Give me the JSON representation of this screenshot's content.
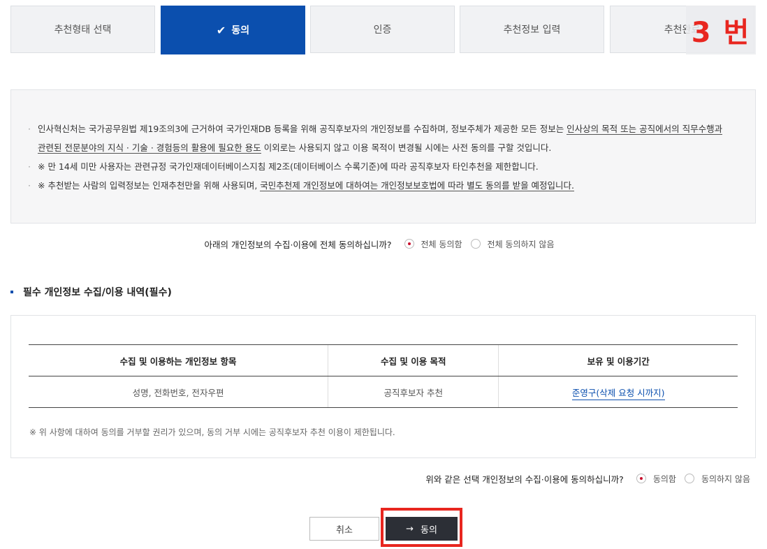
{
  "steps": [
    {
      "label": "추천형태 선택",
      "active": false
    },
    {
      "label": "동의",
      "active": true
    },
    {
      "label": "인증",
      "active": false
    },
    {
      "label": "추천정보 입력",
      "active": false
    },
    {
      "label": "추천완료",
      "active": false
    }
  ],
  "overlay_label": "3 번",
  "notice": {
    "line1_a": "인사혁신처는 국가공무원법 제19조의3에 근거하여 국가인재DB 등록을 위해 공직후보자의 개인정보를 수집하며, 정보주체가 제공한 모든 정보는 ",
    "line1_u": "인사상의 목적 또는 공직에서의 직무수행과",
    "line2_u": "관련된 전문분야의 지식 · 기술 · 경험등의 활용에 필요한 용도",
    "line2_b": " 이외로는 사용되지 않고 이용 목적이 변경될 시에는 사전 동의를 구할 것입니다.",
    "line3": "※ 만 14세 미만 사용자는 관련규정 국가인재데이터베이스지침 제2조(데이터베이스 수록기준)에 따라 공직후보자 타인추천을 제한합니다.",
    "line4_a": "※ 추천받는 사람의 입력정보는 인재추천만을 위해 사용되며, ",
    "line4_u": "국민추천제 개인정보에 대하여는 개인정보보호법에 따라 별도 동의를 받을 예정입니다."
  },
  "all_consent": {
    "question": "아래의 개인정보의 수집·이용에 전체 동의하십니까?",
    "agree": "전체 동의함",
    "disagree": "전체 동의하지 않음",
    "selected": "agree"
  },
  "section_title": "필수 개인정보 수집/이용 내역(필수)",
  "table": {
    "headers": [
      "수집 및 이용하는 개인정보 항목",
      "수집 및 이용 목적",
      "보유 및 이용기간"
    ],
    "row": [
      "성명, 전화번호, 전자우편",
      "공직후보자 추천",
      "준영구(삭제 요청 시까지)"
    ]
  },
  "table_note": "※ 위 사항에 대하여 동의를 거부할 권리가 있으며, 동의 거부 시에는 공직후보자 추천 이용이 제한됩니다.",
  "select_consent": {
    "question": "위와 같은 선택 개인정보의 수집·이용에 동의하십니까?",
    "agree": "동의함",
    "disagree": "동의하지 않음",
    "selected": "agree"
  },
  "buttons": {
    "cancel": "취소",
    "agree_arrow": "→",
    "agree": "동의"
  },
  "colors": {
    "primary": "#0b4fae",
    "highlight": "#e8261f"
  }
}
